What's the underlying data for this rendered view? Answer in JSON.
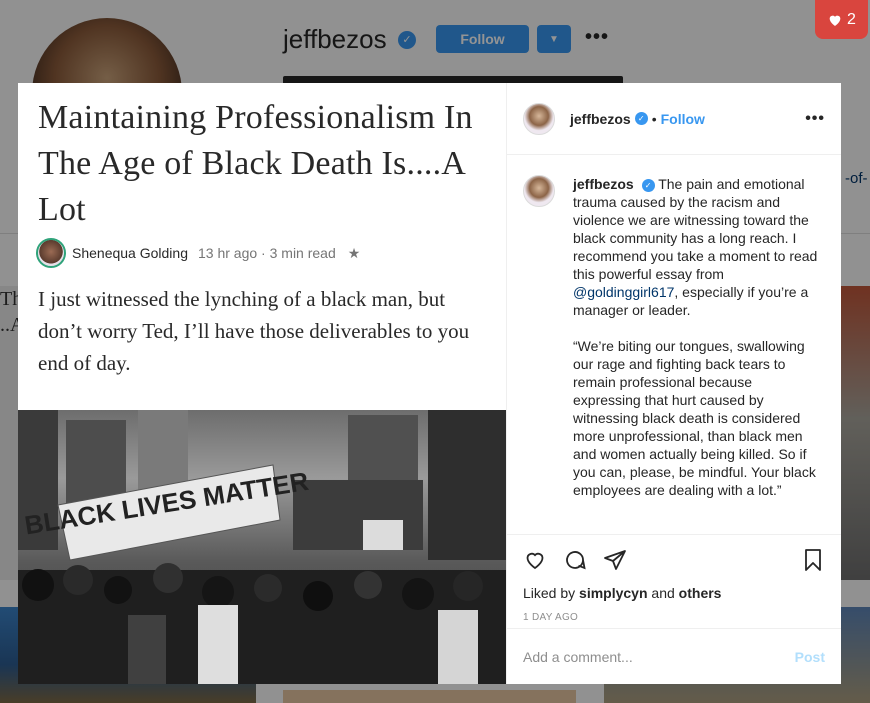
{
  "profile": {
    "username": "jeffbezos",
    "follow_label": "Follow",
    "dropdown_icon": "triangle-down-icon",
    "more_icon": "ellipsis-icon",
    "link_fragment": "-of-"
  },
  "notification": {
    "likes_count": "2",
    "icon": "heart-icon",
    "color": "#d9453e"
  },
  "post": {
    "image": {
      "title": "Maintaining Professionalism In The Age of Black Death Is....A Lot",
      "author": "Shenequa Golding",
      "meta": "13 hr ago · 3 min read",
      "star": "★",
      "body": "I just witnessed the lynching of a black man, but don’t worry Ted, I’ll have those deliverables to you end of day.",
      "photo_sign": "BLACK LIVES MATTER"
    },
    "header": {
      "username": "jeffbezos",
      "dot": "•",
      "follow_label": "Follow",
      "more": "•••"
    },
    "caption": {
      "username": "jeffbezos",
      "text_before_mention": "The pain and emotional trauma caused by the racism and violence we are witnessing toward the black community has a long reach. I recommend you take a moment to read this powerful essay from ",
      "mention": "@goldinggirl617",
      "text_after_mention": ", especially if you’re a manager or leader.",
      "quote": "“We’re biting our tongues, swallowing our rage and fighting back tears to remain professional because expressing that hurt caused by witnessing black death is considered more unprofessional, than black men and women actually being killed. So if you can, please, be mindful. Your black employees are dealing with a lot.”"
    },
    "liked_by_prefix": "Liked by",
    "liked_by_user": "simplycyn",
    "liked_by_and": "and",
    "liked_by_others": "others",
    "timestamp": "1 DAY AGO",
    "comment_placeholder": "Add a comment...",
    "post_label": "Post"
  },
  "colors": {
    "accent": "#3897f0",
    "link": "#003569",
    "post_disabled": "#b2dffc"
  }
}
